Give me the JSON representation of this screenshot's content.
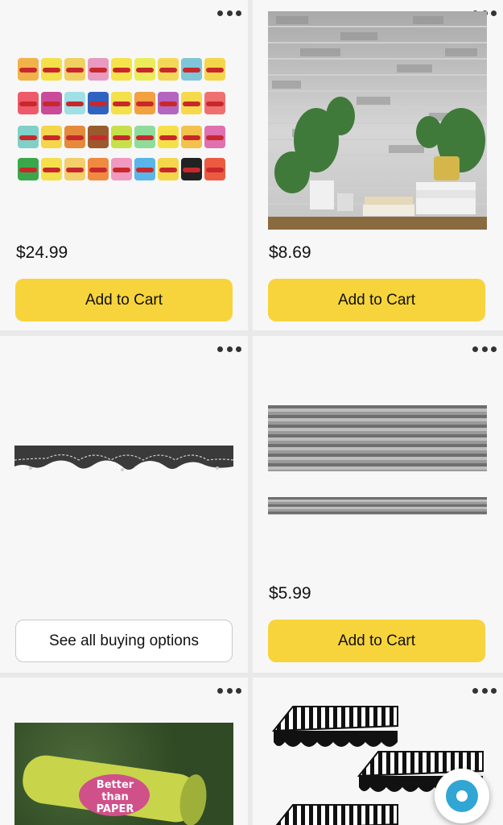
{
  "products": [
    {
      "price": "$24.99",
      "button_label": "Add to Cart"
    },
    {
      "price": "$8.69",
      "button_label": "Add to Cart"
    },
    {
      "price": "",
      "button_label": "See all buying options"
    },
    {
      "price": "$5.99",
      "button_label": "Add to Cart"
    },
    {
      "image_text": "Better than PAPER"
    },
    {}
  ],
  "icons": {
    "more": "more-options-icon",
    "assistant": "alexa-icon"
  },
  "colors": {
    "cart_button": "#f7d43c",
    "card_bg": "#f7f7f8",
    "alexa": "#31a6d4"
  }
}
